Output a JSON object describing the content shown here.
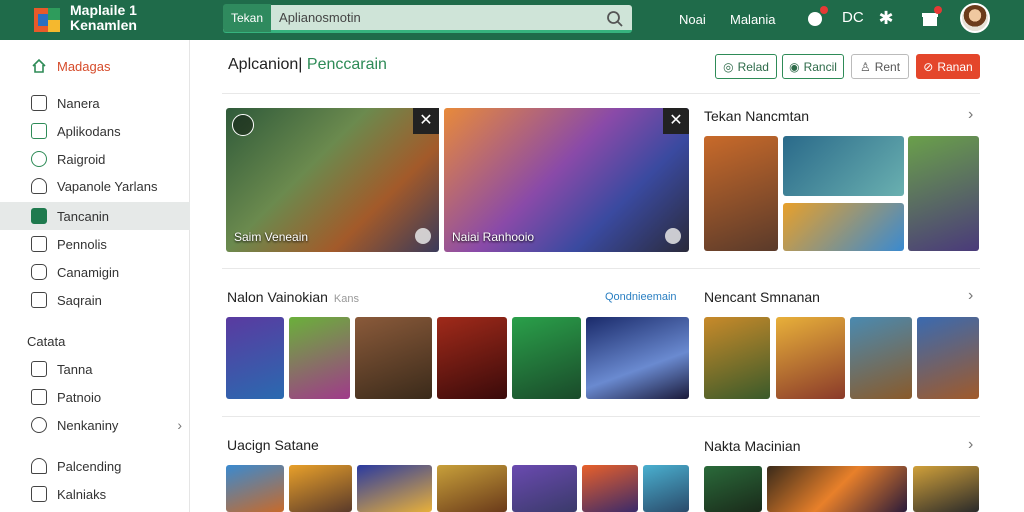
{
  "app": {
    "brand_line1": "Maplaile 1",
    "brand_line2": "Kenamlen"
  },
  "search": {
    "tab_label": "Tekan",
    "value": "Aplianosmotin",
    "placeholder": ""
  },
  "topnav": {
    "link1": "Noai",
    "link2": "Malania",
    "link3": "DC"
  },
  "sidebar": {
    "items": [
      {
        "label": "Madagas"
      },
      {
        "label": "Nanera"
      },
      {
        "label": "Aplikodans"
      },
      {
        "label": "Raigroid"
      },
      {
        "label": "Vapanole Yarlans"
      },
      {
        "label": "Tancanin"
      },
      {
        "label": "Pennolis"
      },
      {
        "label": "Canamigin"
      },
      {
        "label": "Saqrain"
      }
    ],
    "section_heading": "Catata",
    "items2": [
      {
        "label": "Tanna"
      },
      {
        "label": "Patnoio"
      },
      {
        "label": "Nenkaniny"
      },
      {
        "label": "Palcending"
      },
      {
        "label": "Kalniaks"
      }
    ]
  },
  "header": {
    "crumb_main": "Aplcanion|",
    "crumb_accent": "Penccarain",
    "btn1": "Relad",
    "btn2": "Rancil",
    "btn3": "Rent",
    "btn4": "Ranan"
  },
  "hero": {
    "card1_title": "Saim Veneain",
    "card2_title": "Naiai Ranhooio"
  },
  "sections": {
    "s1_title": "Tekan Nancmtan",
    "s2_title": "Nalon Vainokian",
    "s2_sub": "Kans",
    "s2_link": "Qondnieemain",
    "s3_title": "Nencant Smnanan",
    "s4_title": "Uacign Satane",
    "s5_title": "Nakta Macinian"
  },
  "colors": {
    "topbar": "#1f6b4a",
    "accent_green": "#2e8b57",
    "accent_red": "#e4462b"
  }
}
